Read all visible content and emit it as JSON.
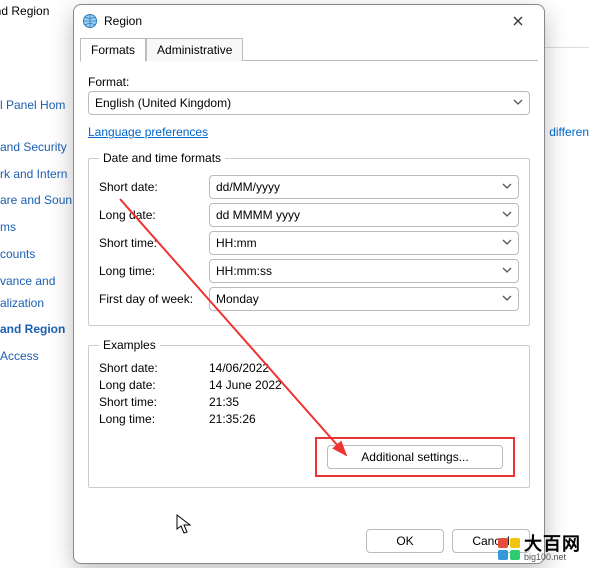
{
  "background": {
    "header_fragment": "and Region",
    "sidebar": {
      "home": "l Panel Hom",
      "items": [
        " and Security",
        "rk and Intern",
        "are and Soun",
        "ms",
        "counts",
        "vance and",
        "alization",
        "and Region",
        " Access"
      ],
      "bold_index": 7
    },
    "right_link": "differen"
  },
  "dialog": {
    "title": "Region",
    "tabs": [
      "Formats",
      "Administrative"
    ],
    "active_tab": 0,
    "format_label": "Format:",
    "format_value": "English (United Kingdom)",
    "lang_prefs": "Language preferences",
    "dt_legend": "Date and time formats",
    "rows": {
      "short_date": {
        "label": "Short date:",
        "value": "dd/MM/yyyy"
      },
      "long_date": {
        "label": "Long date:",
        "value": "dd MMMM yyyy"
      },
      "short_time": {
        "label": "Short time:",
        "value": "HH:mm"
      },
      "long_time": {
        "label": "Long time:",
        "value": "HH:mm:ss"
      },
      "first_day": {
        "label": "First day of week:",
        "value": "Monday"
      }
    },
    "ex_legend": "Examples",
    "examples": {
      "short_date": {
        "label": "Short date:",
        "value": "14/06/2022"
      },
      "long_date": {
        "label": "Long date:",
        "value": "14 June 2022"
      },
      "short_time": {
        "label": "Short time:",
        "value": "21:35"
      },
      "long_time": {
        "label": "Long time:",
        "value": "21:35:26"
      }
    },
    "additional_btn": "Additional settings...",
    "ok": "OK",
    "cancel": "Cancel"
  },
  "watermark": {
    "big": "大百网",
    "small": "big100.net"
  }
}
